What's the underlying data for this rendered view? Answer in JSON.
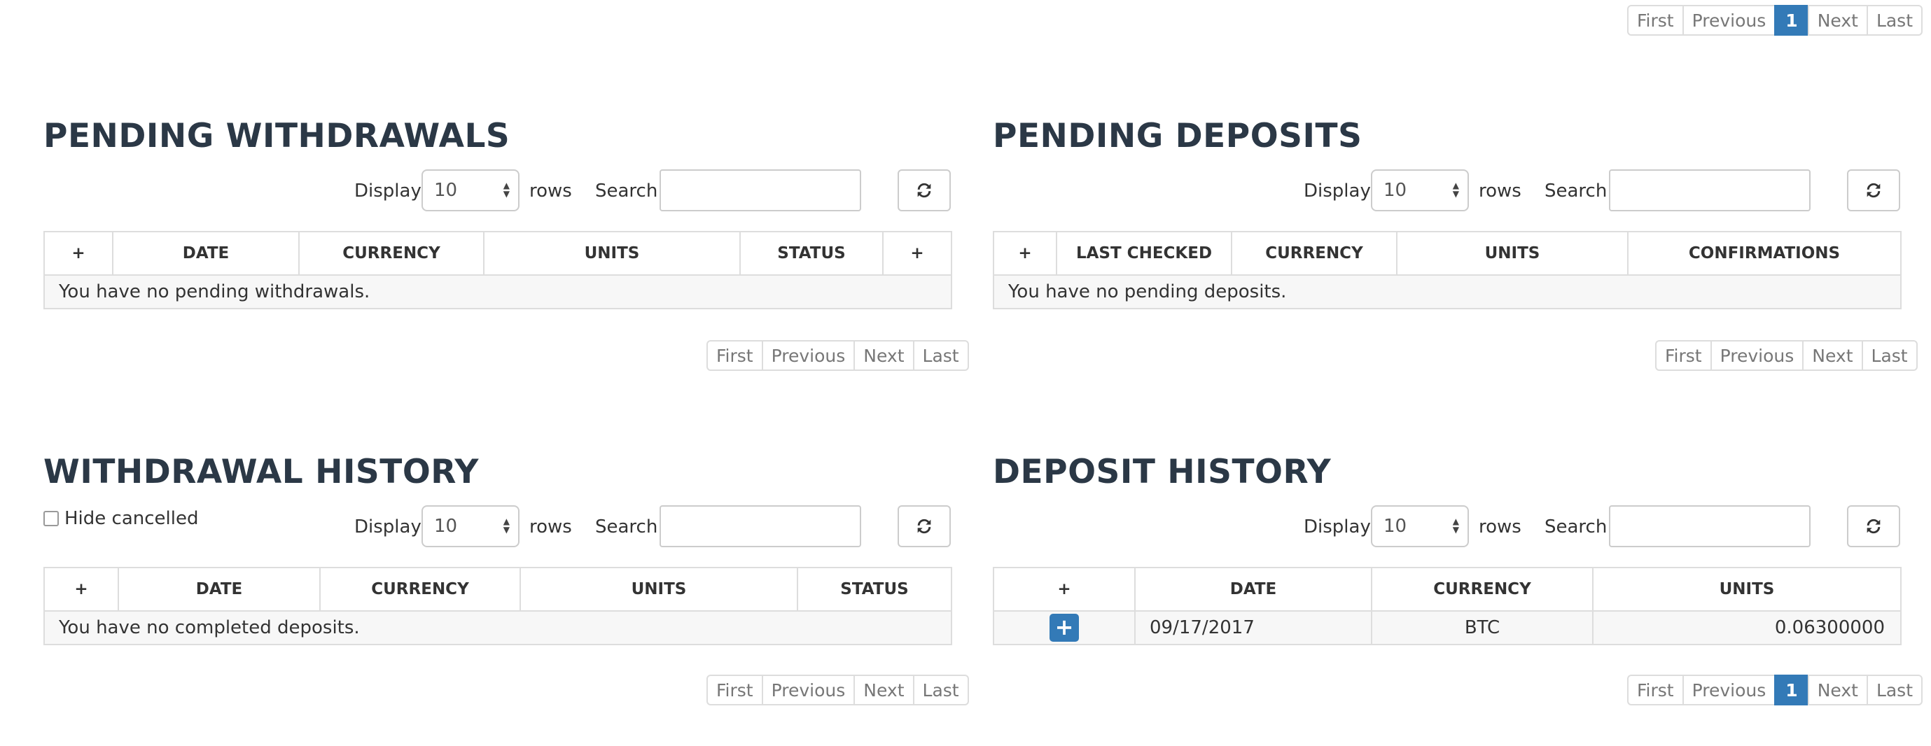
{
  "top_pager": {
    "first": "First",
    "previous": "Previous",
    "page": "1",
    "next": "Next",
    "last": "Last"
  },
  "pending_withdrawals": {
    "title": "PENDING WITHDRAWALS",
    "display_label": "Display",
    "rows_value": "10",
    "rows_label": "rows",
    "search_label": "Search:",
    "search_value": "",
    "columns": [
      "+",
      "DATE",
      "CURRENCY",
      "UNITS",
      "STATUS",
      "+"
    ],
    "empty_message": "You have no pending withdrawals.",
    "pager": {
      "first": "First",
      "previous": "Previous",
      "next": "Next",
      "last": "Last"
    }
  },
  "pending_deposits": {
    "title": "PENDING DEPOSITS",
    "display_label": "Display",
    "rows_value": "10",
    "rows_label": "rows",
    "search_label": "Search:",
    "search_value": "",
    "columns": [
      "+",
      "LAST CHECKED",
      "CURRENCY",
      "UNITS",
      "CONFIRMATIONS"
    ],
    "empty_message": "You have no pending deposits.",
    "pager": {
      "first": "First",
      "previous": "Previous",
      "next": "Next",
      "last": "Last"
    }
  },
  "withdrawal_history": {
    "title": "WITHDRAWAL HISTORY",
    "hide_cancelled_label": "Hide cancelled",
    "display_label": "Display",
    "rows_value": "10",
    "rows_label": "rows",
    "search_label": "Search:",
    "search_value": "",
    "columns": [
      "+",
      "DATE",
      "CURRENCY",
      "UNITS",
      "STATUS"
    ],
    "empty_message": "You have no completed deposits.",
    "pager": {
      "first": "First",
      "previous": "Previous",
      "next": "Next",
      "last": "Last"
    }
  },
  "deposit_history": {
    "title": "DEPOSIT HISTORY",
    "display_label": "Display",
    "rows_value": "10",
    "rows_label": "rows",
    "search_label": "Search:",
    "search_value": "",
    "columns": [
      "+",
      "DATE",
      "CURRENCY",
      "UNITS"
    ],
    "rows": [
      {
        "expand": "+",
        "date": "09/17/2017",
        "currency": "BTC",
        "units": "0.06300000"
      }
    ],
    "pager": {
      "first": "First",
      "previous": "Previous",
      "page": "1",
      "next": "Next",
      "last": "Last"
    }
  },
  "colors": {
    "accent": "#337ab7",
    "heading": "#2b3846",
    "border": "#dddddd"
  },
  "icons": {
    "refresh": "refresh-icon",
    "expand": "plus-icon"
  }
}
